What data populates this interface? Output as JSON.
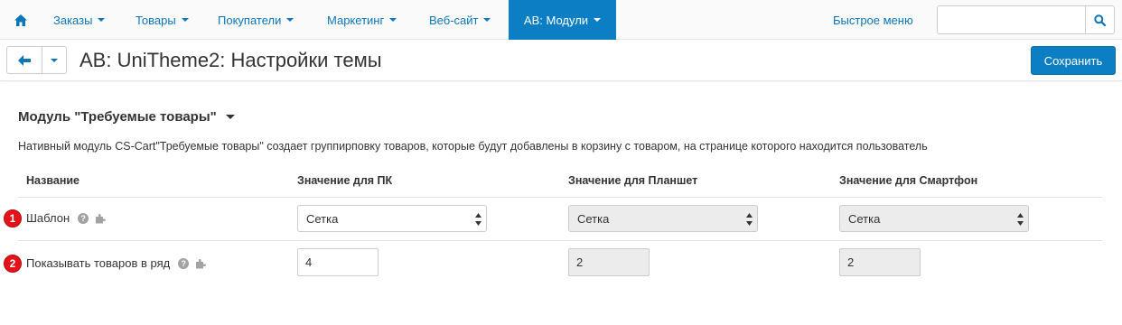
{
  "nav": {
    "items": [
      {
        "label": "Заказы"
      },
      {
        "label": "Товары"
      },
      {
        "label": "Покупатели"
      },
      {
        "label": "Маркетинг"
      },
      {
        "label": "Веб-сайт"
      },
      {
        "label": "AB: Модули"
      }
    ],
    "active_index": 5,
    "quick_menu": "Быстрое меню",
    "search_value": ""
  },
  "toolbar": {
    "title": "AB: UniTheme2: Настройки темы",
    "save_label": "Сохранить"
  },
  "section": {
    "title": "Модуль \"Требуемые товары\"",
    "description": "Нативный модуль CS-Cart\"Требуемые товары\" создает группирповку товаров, которые будут добавлены в корзину с товаром, на странице которого находится пользователь"
  },
  "table": {
    "headers": [
      "Название",
      "Значение для ПК",
      "Значение для Планшет",
      "Значение для Смартфон"
    ],
    "rows": [
      {
        "badge": "1",
        "label": "Шаблон",
        "pc": "Сетка",
        "tablet": "Сетка",
        "phone": "Сетка"
      },
      {
        "badge": "2",
        "label": "Показывать товаров в ряд",
        "pc": "4",
        "tablet": "2",
        "phone": "2"
      }
    ]
  },
  "colors": {
    "accent": "#0b7ec4",
    "link": "#0b76b8",
    "badge": "#e3121b"
  }
}
